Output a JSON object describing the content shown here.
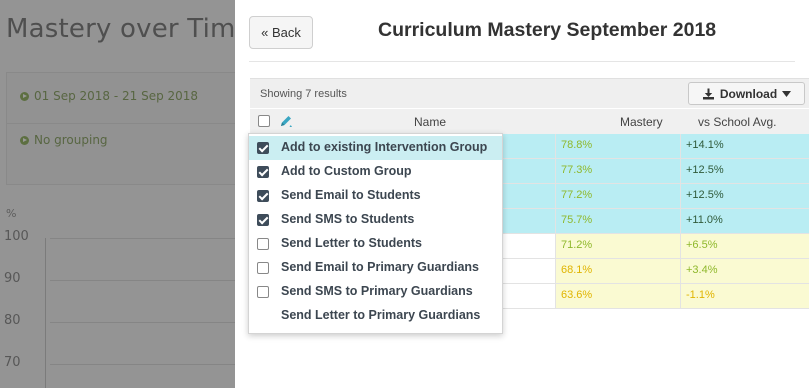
{
  "background": {
    "title": "Mastery over Tim",
    "date_filter": "01 Sep 2018 - 21 Sep 2018",
    "grouping": "No grouping",
    "y_unit": "%",
    "y_ticks": [
      "100",
      "90",
      "80",
      "70"
    ]
  },
  "modal": {
    "back_label": "« Back",
    "title": "Curriculum Mastery September 2018",
    "results_text": "Showing 7 results",
    "download_label": "Download",
    "columns": {
      "name": "Name",
      "mastery": "Mastery",
      "vs_school": "vs School Avg."
    }
  },
  "rows": [
    {
      "mastery": "78.8%",
      "vs": "+14.1%"
    },
    {
      "mastery": "77.3%",
      "vs": "+12.5%"
    },
    {
      "mastery": "77.2%",
      "vs": "+12.5%"
    },
    {
      "mastery": "75.7%",
      "vs": "+11.0%"
    },
    {
      "mastery": "71.2%",
      "vs": "+6.5%"
    },
    {
      "mastery": "68.1%",
      "vs": "+3.4%"
    },
    {
      "mastery": "63.6%",
      "vs": "-1.1%"
    }
  ],
  "menu": {
    "items": [
      {
        "label": "Add to existing Intervention Group",
        "checked": true
      },
      {
        "label": "Add to Custom Group",
        "checked": true
      },
      {
        "label": "Send Email to Students",
        "checked": true
      },
      {
        "label": "Send SMS to Students",
        "checked": true
      },
      {
        "label": "Send Letter to Students",
        "checked": false
      },
      {
        "label": "Send Email to Primary Guardians",
        "checked": false
      },
      {
        "label": "Send SMS to Primary Guardians",
        "checked": false
      },
      {
        "label": "Send Letter to Primary Guardians",
        "checked": null
      }
    ]
  },
  "colors": {
    "row_selected": "#b9edf3",
    "row_yellow": "#fafad2",
    "text_green": "#8fb82c",
    "text_orange": "#e0b400",
    "accent_green": "#7aa33d"
  },
  "icons": {
    "download": "download-icon",
    "caret": "caret-down-icon",
    "edit": "pencil-icon",
    "play": "play-circle-icon"
  }
}
